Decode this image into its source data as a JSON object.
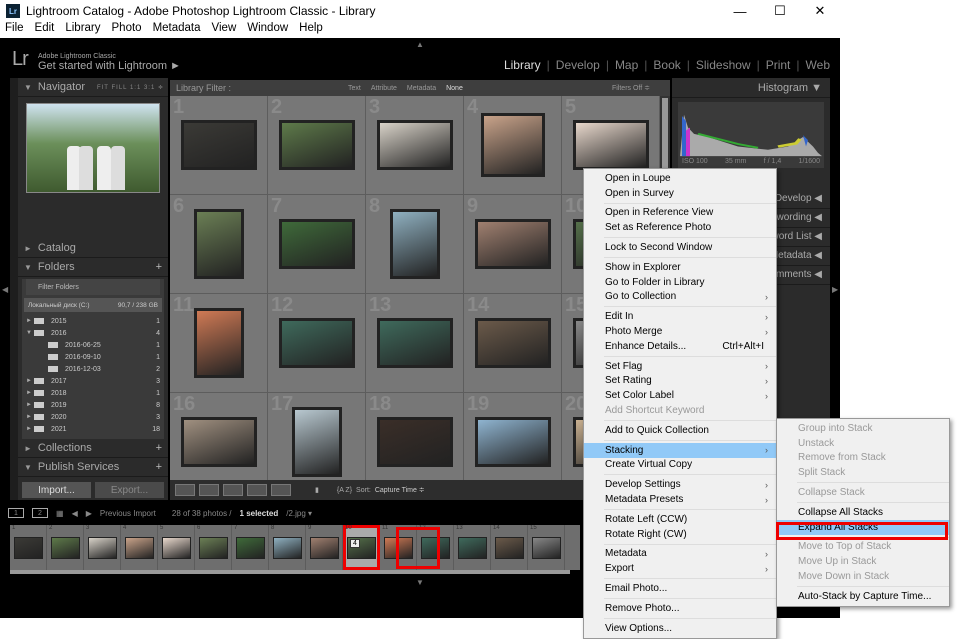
{
  "window": {
    "title": "Lightroom Catalog - Adobe Photoshop Lightroom Classic - Library",
    "icon": "Lr",
    "minimize": "—",
    "maximize": "☐",
    "close": "✕"
  },
  "menubar": [
    "File",
    "Edit",
    "Library",
    "Photo",
    "Metadata",
    "View",
    "Window",
    "Help"
  ],
  "header": {
    "logo": "Lr",
    "product": "Adobe Lightroom Classic",
    "tagline": "Get started with Lightroom ►",
    "modules": [
      "Library",
      "Develop",
      "Map",
      "Book",
      "Slideshow",
      "Print",
      "Web"
    ],
    "active_module": "Library"
  },
  "left_panel": {
    "navigator": {
      "title": "Navigator",
      "options": "FIT  FILL  1:1  3:1 ≑"
    },
    "catalog": "Catalog",
    "folders": {
      "title": "Folders",
      "filter": "Filter Folders",
      "drive": "Локальный диск (C:)",
      "drive_space": "90,7 / 238 GB",
      "items": [
        {
          "name": "2015",
          "count": "1",
          "level": 0,
          "open": false
        },
        {
          "name": "2016",
          "count": "4",
          "level": 0,
          "open": true
        },
        {
          "name": "2016-06-25",
          "count": "1",
          "level": 1
        },
        {
          "name": "2016-09-10",
          "count": "1",
          "level": 1
        },
        {
          "name": "2016-12-03",
          "count": "2",
          "level": 1
        },
        {
          "name": "2017",
          "count": "3",
          "level": 0
        },
        {
          "name": "2018",
          "count": "1",
          "level": 0
        },
        {
          "name": "2019",
          "count": "8",
          "level": 0
        },
        {
          "name": "2020",
          "count": "3",
          "level": 0
        },
        {
          "name": "2021",
          "count": "18",
          "level": 0
        }
      ]
    },
    "collections": "Collections",
    "publish": "Publish Services",
    "import": "Import...",
    "export": "Export..."
  },
  "filter_bar": {
    "label": "Library Filter :",
    "options": [
      "Text",
      "Attribute",
      "Metadata",
      "None"
    ],
    "status": "Filters Off ≑"
  },
  "grid": [
    {
      "num": "1",
      "shape": "landscape",
      "color": "#3b3a36"
    },
    {
      "num": "2",
      "shape": "landscape",
      "color": "#5e7a4a"
    },
    {
      "num": "3",
      "shape": "landscape",
      "color": "#d8d2c8"
    },
    {
      "num": "4",
      "shape": "square",
      "color": "#c9a38a"
    },
    {
      "num": "5",
      "shape": "landscape",
      "color": "#e8d8cc"
    },
    {
      "num": "6",
      "shape": "portrait",
      "color": "#6b7f55"
    },
    {
      "num": "7",
      "shape": "landscape",
      "color": "#3f6a3a"
    },
    {
      "num": "8",
      "shape": "portrait",
      "color": "#8fb0c0"
    },
    {
      "num": "9",
      "shape": "landscape",
      "color": "#a08070"
    },
    {
      "num": "10",
      "shape": "landscape",
      "color": "#55704a"
    },
    {
      "num": "11",
      "shape": "portrait",
      "color": "#d07a55"
    },
    {
      "num": "12",
      "shape": "landscape",
      "color": "#3f6a5c"
    },
    {
      "num": "13",
      "shape": "landscape",
      "color": "#3f6a5c"
    },
    {
      "num": "14",
      "shape": "landscape",
      "color": "#6b5a4a"
    },
    {
      "num": "15",
      "shape": "landscape",
      "color": "#888"
    },
    {
      "num": "16",
      "shape": "landscape",
      "color": "#a09080"
    },
    {
      "num": "17",
      "shape": "portrait",
      "color": "#b8c8d0"
    },
    {
      "num": "18",
      "shape": "landscape",
      "color": "#3a2e28"
    },
    {
      "num": "19",
      "shape": "landscape",
      "color": "#8fb4d0"
    },
    {
      "num": "20",
      "shape": "landscape",
      "color": "#c9b090"
    }
  ],
  "toolbar": {
    "sort_label": "Sort:",
    "sort_value": "Capture Time ≑"
  },
  "right_panel": {
    "histogram": "Histogram",
    "iso": "ISO 100",
    "focal": "35 mm",
    "aperture": "f / 1,4",
    "shutter": "1/1600",
    "sections": [
      "Quick Develop",
      "Keywording",
      "Keyword List",
      "Metadata",
      "Comments"
    ]
  },
  "filmstrip": {
    "page1": "1",
    "page2": "2",
    "source": "Previous Import",
    "count": "28 of 38 photos /",
    "selected": "1 selected",
    "file": "/2.jpg ▾",
    "items": [
      {
        "n": "1",
        "c": "#3b3a36"
      },
      {
        "n": "2",
        "c": "#5e7a4a"
      },
      {
        "n": "3",
        "c": "#d8d2c8"
      },
      {
        "n": "4",
        "c": "#c9a38a"
      },
      {
        "n": "5",
        "c": "#e8d8cc"
      },
      {
        "n": "6",
        "c": "#6b7f55"
      },
      {
        "n": "7",
        "c": "#3f6a3a"
      },
      {
        "n": "8",
        "c": "#8fb0c0"
      },
      {
        "n": "9",
        "c": "#a08070"
      },
      {
        "n": "10",
        "c": "#55704a",
        "stack": "4"
      },
      {
        "n": "11",
        "c": "#d07a55"
      },
      {
        "n": "12",
        "c": "#3f6a5c"
      },
      {
        "n": "13",
        "c": "#3f6a5c"
      },
      {
        "n": "14",
        "c": "#6b5a4a"
      },
      {
        "n": "15",
        "c": "#888"
      }
    ]
  },
  "context_menu": [
    {
      "label": "Open in Loupe"
    },
    {
      "label": "Open in Survey"
    },
    {
      "sep": true
    },
    {
      "label": "Open in Reference View"
    },
    {
      "label": "Set as Reference Photo"
    },
    {
      "sep": true
    },
    {
      "label": "Lock to Second Window"
    },
    {
      "sep": true
    },
    {
      "label": "Show in Explorer"
    },
    {
      "label": "Go to Folder in Library"
    },
    {
      "label": "Go to Collection",
      "sub": true
    },
    {
      "sep": true
    },
    {
      "label": "Edit In",
      "sub": true
    },
    {
      "label": "Photo Merge",
      "sub": true
    },
    {
      "label": "Enhance Details...",
      "shortcut": "Ctrl+Alt+I"
    },
    {
      "sep": true
    },
    {
      "label": "Set Flag",
      "sub": true
    },
    {
      "label": "Set Rating",
      "sub": true
    },
    {
      "label": "Set Color Label",
      "sub": true
    },
    {
      "label": "Add Shortcut Keyword",
      "disabled": true
    },
    {
      "sep": true
    },
    {
      "label": "Add to Quick Collection"
    },
    {
      "sep": true
    },
    {
      "label": "Stacking",
      "sub": true,
      "highlight": true
    },
    {
      "label": "Create Virtual Copy"
    },
    {
      "sep": true
    },
    {
      "label": "Develop Settings",
      "sub": true
    },
    {
      "label": "Metadata Presets",
      "sub": true
    },
    {
      "sep": true
    },
    {
      "label": "Rotate Left (CCW)"
    },
    {
      "label": "Rotate Right (CW)"
    },
    {
      "sep": true
    },
    {
      "label": "Metadata",
      "sub": true
    },
    {
      "label": "Export",
      "sub": true
    },
    {
      "sep": true
    },
    {
      "label": "Email Photo..."
    },
    {
      "sep": true
    },
    {
      "label": "Remove Photo..."
    },
    {
      "sep": true
    },
    {
      "label": "View Options..."
    }
  ],
  "stacking_submenu": [
    {
      "label": "Group into Stack",
      "disabled": true
    },
    {
      "label": "Unstack",
      "disabled": true
    },
    {
      "label": "Remove from Stack",
      "disabled": true
    },
    {
      "label": "Split Stack",
      "disabled": true
    },
    {
      "sep": true
    },
    {
      "label": "Collapse Stack",
      "disabled": true
    },
    {
      "sep": true
    },
    {
      "label": "Collapse All Stacks"
    },
    {
      "label": "Expand All Stacks",
      "highlight": true
    },
    {
      "sep": true
    },
    {
      "label": "Move to Top of Stack",
      "disabled": true
    },
    {
      "label": "Move Up in Stack",
      "disabled": true
    },
    {
      "label": "Move Down in Stack",
      "disabled": true
    },
    {
      "sep": true
    },
    {
      "label": "Auto-Stack by Capture Time..."
    }
  ],
  "colors": {
    "highlight": "#91c9f7",
    "callout": "#ee0000"
  }
}
